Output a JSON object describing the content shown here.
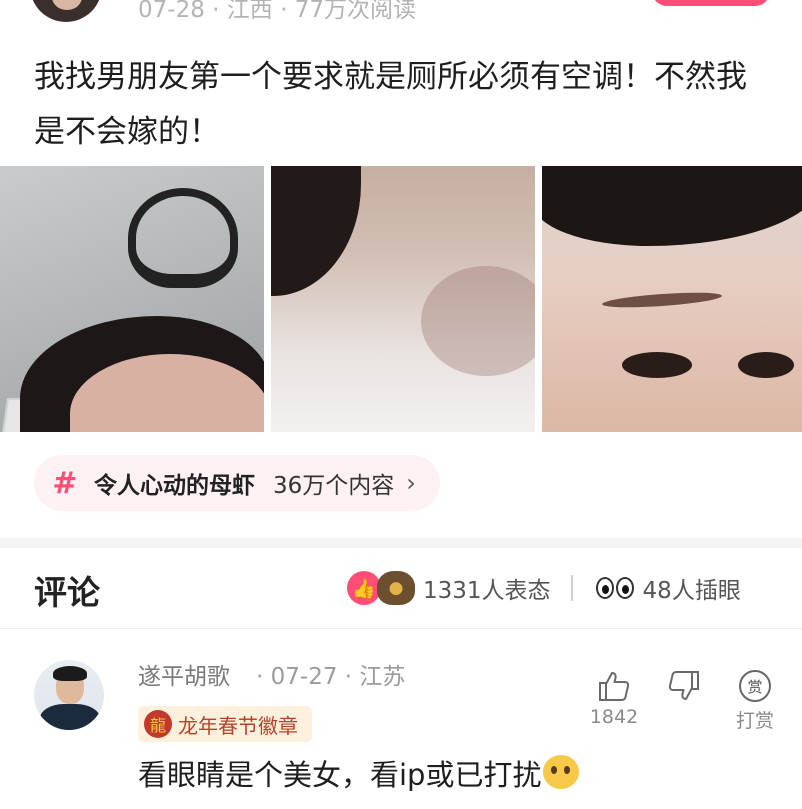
{
  "post_header": {
    "meta": "07-28 · 江西 · 77万次阅读"
  },
  "post": {
    "text": "我找男朋友第一个要求就是厕所必须有空调！不然我是不会嫁的！"
  },
  "topic": {
    "hash": "#",
    "name": "令人心动的母虾",
    "count": "36万个内容",
    "chevron": "›"
  },
  "comments_section": {
    "title": "评论",
    "reaction_count": "1331人表态",
    "peek_count": "48人插眼",
    "like_glyph": "👍"
  },
  "comment": {
    "author": "遂平胡歌",
    "meta": "· 07-27 · 江苏",
    "badge": "龙年春节徽章",
    "text": "看眼睛是个美女，看ip或已打扰",
    "like_count": "1842",
    "reward_label": "打赏",
    "reward_glyph": "赏"
  },
  "colors": {
    "accent": "#ff4d75",
    "topic_bg": "#fdf1f3",
    "badge_bg": "#fdf0dd"
  }
}
